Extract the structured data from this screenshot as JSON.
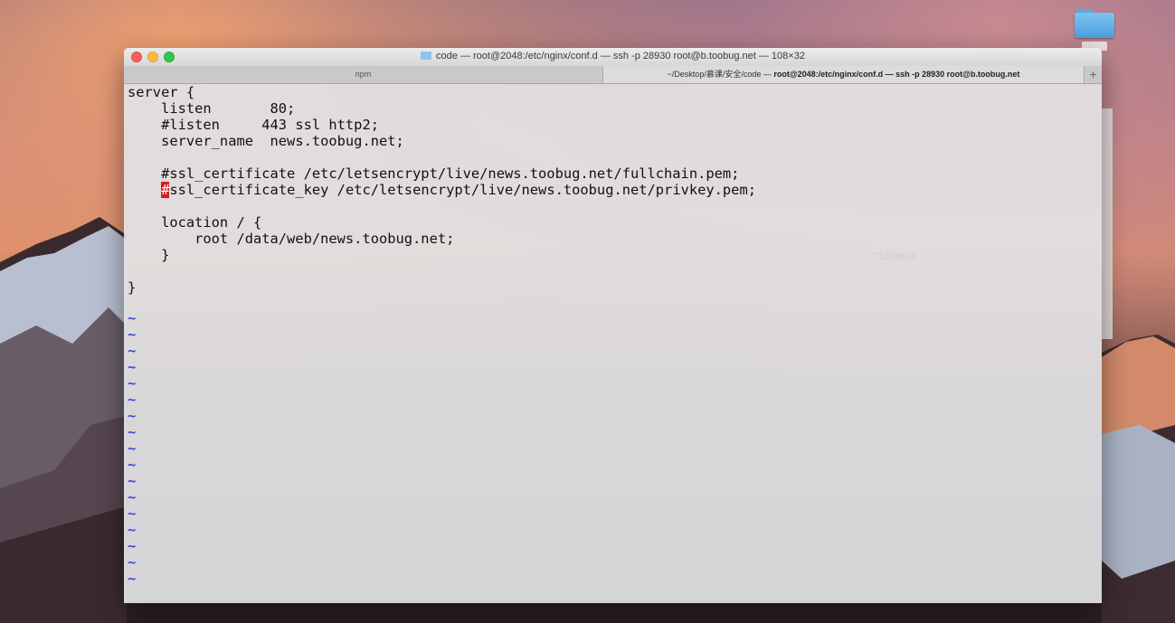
{
  "window": {
    "title": "code — root@2048:/etc/nginx/conf.d — ssh -p 28930 root@b.toobug.net — 108×32"
  },
  "tabs": [
    {
      "label": "npm",
      "active": false
    },
    {
      "label_prefix": "~/Desktop/慕课/安全/code — ",
      "label_bold": "root@2048:/etc/nginx/conf.d — ssh -p 28930 root@b.toobug.net",
      "active": true
    }
  ],
  "editor": {
    "lines": [
      "server {",
      "    listen       80;",
      "    #listen     443 ssl http2;",
      "    server_name  news.toobug.net;",
      "",
      "    #ssl_certificate /etc/letsencrypt/live/news.toobug.net/fullchain.pem;",
      "ssl_certificate_key /etc/letsencrypt/live/news.toobug.net/privkey.pem;",
      "",
      "    location / {",
      "        root /data/web/news.toobug.net;",
      "    }",
      "",
      "}"
    ],
    "cursor_line_indent": "    ",
    "cursor_char": "#",
    "tilde": "~",
    "watermark": "712390513"
  },
  "colors": {
    "tilde": "#3548e0",
    "cursor": "#d21e1e",
    "close": "#fc605c",
    "minimize": "#fdbc40",
    "maximize": "#34c84a"
  },
  "icons": [
    "folder-icon",
    "close-button",
    "minimize-button",
    "zoom-button",
    "add-tab-icon"
  ]
}
